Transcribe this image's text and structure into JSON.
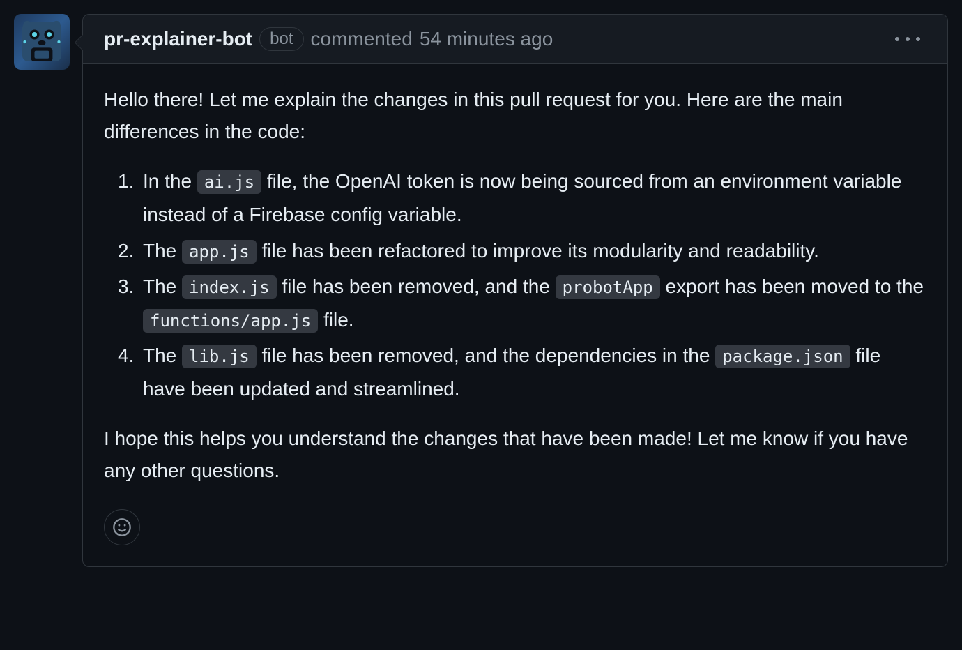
{
  "comment": {
    "author": "pr-explainer-bot",
    "bot_label": "bot",
    "action": "commented",
    "timestamp": "54 minutes ago",
    "intro": "Hello there! Let me explain the changes in this pull request for you. Here are the main differences in the code:",
    "changes": [
      {
        "prefix": "In the ",
        "code1": "ai.js",
        "middle": " file, the OpenAI token is now being sourced from an environment variable instead of a Firebase config variable.",
        "code2": "",
        "suffix": ""
      },
      {
        "prefix": "The ",
        "code1": "app.js",
        "middle": " file has been refactored to improve its modularity and readability.",
        "code2": "",
        "suffix": ""
      },
      {
        "prefix": "The ",
        "code1": "index.js",
        "middle": " file has been removed, and the ",
        "code2": "probotApp",
        "middle2": " export has been moved to the ",
        "code3": "functions/app.js",
        "suffix": " file."
      },
      {
        "prefix": "The ",
        "code1": "lib.js",
        "middle": " file has been removed, and the dependencies in the ",
        "code2": "package.json",
        "suffix": " file have been updated and streamlined."
      }
    ],
    "outro": "I hope this helps you understand the changes that have been made! Let me know if you have any other questions."
  }
}
